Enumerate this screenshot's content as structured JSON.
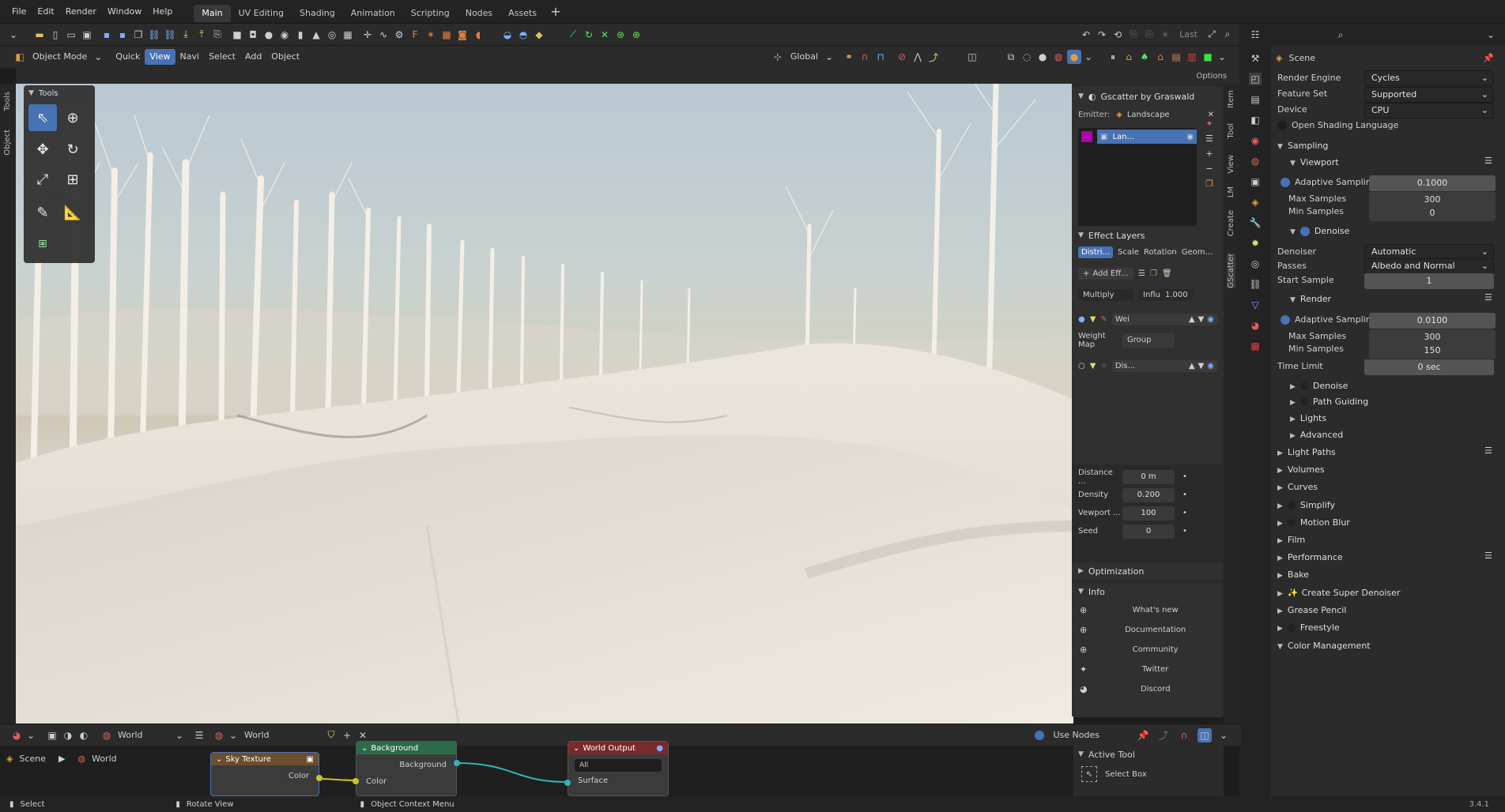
{
  "menu": [
    "File",
    "Edit",
    "Render",
    "Window",
    "Help"
  ],
  "workspaces": [
    "Main",
    "UV Editing",
    "Shading",
    "Animation",
    "Scripting",
    "Nodes",
    "Assets"
  ],
  "active_workspace": "Main",
  "header": {
    "mode": "Object Mode",
    "items": [
      "Quick",
      "View",
      "Navi",
      "Select",
      "Add",
      "Object"
    ],
    "active_item": "View",
    "transform": "Global",
    "options": "Options",
    "last": "Last"
  },
  "left_tabs": [
    "Tools",
    "Object"
  ],
  "tools_title": "Tools",
  "npanel": {
    "gscatter_title": "Gscatter by Graswald",
    "emitter_label": "Emitter:",
    "emitter_value": "Landscape",
    "layer_name": "Lan...",
    "effect_layers": "Effect Layers",
    "tabs": [
      "Distri...",
      "Scale",
      "Rotation",
      "Geom..."
    ],
    "add_effect": "Add Eff...",
    "blend": "Multiply",
    "influ_label": "Influ",
    "influ_value": "1.000",
    "weight_item": "Wei",
    "weight_map_label": "Weight Map",
    "weight_map_value": "Group",
    "dist_item": "Dis...",
    "params": [
      {
        "label": "Distance ...",
        "value": "0 m"
      },
      {
        "label": "Density",
        "value": "0.200"
      },
      {
        "label": "Vewport ...",
        "value": "100"
      },
      {
        "label": "Seed",
        "value": "0"
      }
    ],
    "optimization": "Optimization",
    "info": "Info",
    "info_links": [
      "What's new",
      "Documentation",
      "Community",
      "Twitter",
      "Discord"
    ],
    "active_tool": "Active Tool",
    "select_box": "Select Box"
  },
  "right_tabs": [
    "Item",
    "Tool",
    "View",
    "LM",
    "Create",
    "GScatter"
  ],
  "props": {
    "scene": "Scene",
    "render_engine_label": "Render Engine",
    "render_engine": "Cycles",
    "feature_set_label": "Feature Set",
    "feature_set": "Supported",
    "device_label": "Device",
    "device": "CPU",
    "osl": "Open Shading Language",
    "sampling": "Sampling",
    "viewport": "Viewport",
    "vp_adaptive": "Adaptive Sampling",
    "vp_adaptive_val": "0.1000",
    "vp_max_label": "Max Samples",
    "vp_max": "300",
    "vp_min_label": "Min Samples",
    "vp_min": "0",
    "denoise": "Denoise",
    "denoiser_label": "Denoiser",
    "denoiser": "Automatic",
    "passes_label": "Passes",
    "passes": "Albedo and Normal",
    "start_sample_label": "Start Sample",
    "start_sample": "1",
    "render": "Render",
    "r_adaptive": "Adaptive Sampling",
    "r_adaptive_val": "0.0100",
    "r_max_label": "Max Samples",
    "r_max": "300",
    "r_min_label": "Min Samples",
    "r_min": "150",
    "time_limit_label": "Time Limit",
    "time_limit": "0 sec",
    "sub_sections": [
      "Denoise",
      "Path Guiding",
      "Lights",
      "Advanced"
    ],
    "sections": [
      "Light Paths",
      "Volumes",
      "Curves",
      "Simplify",
      "Motion Blur",
      "Film",
      "Performance",
      "Bake",
      "Create Super Denoiser",
      "Grease Pencil",
      "Freestyle",
      "Color Management"
    ]
  },
  "nodebar": {
    "world1": "World",
    "world2": "World",
    "use_nodes": "Use Nodes"
  },
  "breadcrumb": {
    "scene": "Scene",
    "world": "World"
  },
  "nodes": {
    "sky": "Sky Texture",
    "sky_out": "Color",
    "bg": "Background",
    "bg_in": "Color",
    "bg_out": "Background",
    "wo": "World Output",
    "wo_target": "All",
    "wo_in": "Surface"
  },
  "status": {
    "select": "Select",
    "rotate": "Rotate View",
    "context": "Object Context Menu",
    "version": "3.4.1"
  }
}
